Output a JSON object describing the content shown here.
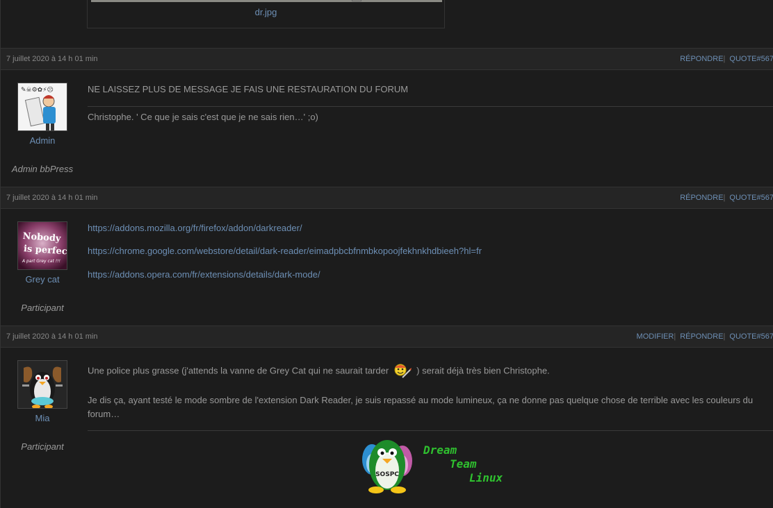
{
  "attachment": {
    "filename": "dr.jpg"
  },
  "actions": {
    "edit": "MODIFIER",
    "reply": "RÉPONDRE",
    "quote": "QUOTE",
    "separator": "|"
  },
  "replies": [
    {
      "date": "7 juillet 2020 à 14 h 01 min",
      "permalink": "#567",
      "author": {
        "name": "Admin",
        "role": "Admin bbPress"
      },
      "message": "NE LAISSEZ PLUS DE MESSAGE JE FAIS UNE RESTAURATION DU FORUM",
      "signature": "Christophe. ' Ce que je sais c'est que je ne sais rien…' ;o)"
    },
    {
      "date": "7 juillet 2020 à 14 h 01 min",
      "permalink": "#567",
      "author": {
        "name": "Grey cat",
        "role": "Participant",
        "avatar_text_1": "Nobody",
        "avatar_text_2": "is perfect",
        "avatar_text_3": "A part Grey cat !!!"
      },
      "links": [
        "https://addons.mozilla.org/fr/firefox/addon/darkreader/",
        "https://chrome.google.com/webstore/detail/dark-reader/eimadpbcbfnmbkopoojfekhnkhdbieeh?hl=fr",
        "https://addons.opera.com/fr/extensions/details/dark-mode/"
      ]
    },
    {
      "date": "7 juillet 2020 à 14 h 01 min",
      "permalink": "#567",
      "author": {
        "name": "Mia",
        "role": "Participant"
      },
      "message_part1": "Une police plus grasse (j'attends la vanne de Grey Cat qui ne saurait tarder",
      "message_part2": ") serait déjà très bien Christophe.",
      "message_para2": "Je dis ça, ayant testé le mode sombre de l'extension Dark Reader, je suis repassé au mode lumineux, ça ne donne pas quelque chose de terrible avec les couleurs du forum…",
      "signature_badge": "SOSPC",
      "signature_words": [
        "Dream",
        "Team",
        "Linux"
      ]
    }
  ],
  "colors": {
    "link": "#6d8fb5",
    "header_bg": "#252525",
    "page_bg": "#1c1c1c",
    "dream_team_green": "#2fc02f"
  }
}
